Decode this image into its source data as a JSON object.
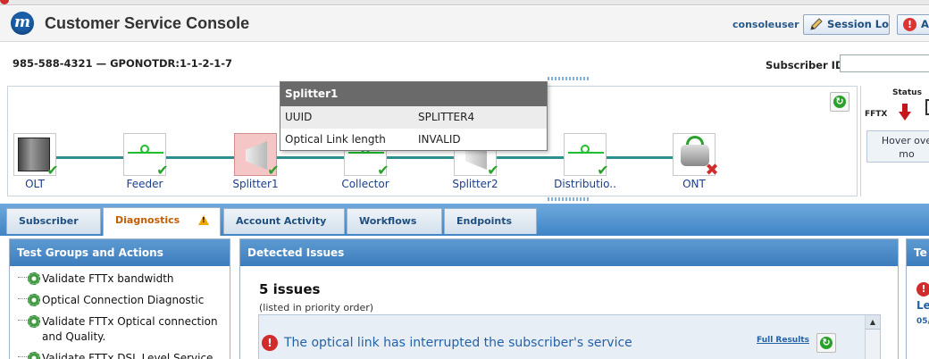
{
  "app": {
    "title": "Customer Service Console",
    "logo_letter": "m",
    "user": "consoleuser",
    "session_log_label": "Session Log",
    "alert_label": "A"
  },
  "subscriber": {
    "line": "985-588-4321 — GPONOTDR:1-1-2-1-7",
    "id_label": "Subscriber ID:",
    "id_value": ""
  },
  "topology": {
    "nodes": [
      {
        "label": "OLT",
        "status": "ok",
        "icon": "olt-icon"
      },
      {
        "label": "Feeder",
        "status": "ok",
        "icon": "fiber-icon"
      },
      {
        "label": "Splitter1",
        "status": "ok",
        "icon": "splitter-icon",
        "selected": true
      },
      {
        "label": "Collector",
        "status": "ok",
        "icon": "fiber-icon"
      },
      {
        "label": "Splitter2",
        "status": "ok",
        "icon": "splitter-icon"
      },
      {
        "label": "Distributio..",
        "status": "ok",
        "icon": "fiber-icon"
      },
      {
        "label": "ONT",
        "status": "error",
        "icon": "ont-icon"
      }
    ],
    "popup": {
      "title": "Splitter1",
      "rows": [
        {
          "key": "UUID",
          "value": "SPLITTER4"
        },
        {
          "key": "Optical Link length",
          "value": "INVALID"
        }
      ]
    }
  },
  "status": {
    "title": "Status",
    "fftx_label": "FFTX",
    "hover_note": "Hover ove\nmo"
  },
  "tabs": [
    {
      "label": "Subscriber",
      "active": false
    },
    {
      "label": "Diagnostics",
      "active": true,
      "warning": true
    },
    {
      "label": "Account Activity",
      "active": false
    },
    {
      "label": "Workflows",
      "active": false
    },
    {
      "label": "Endpoints",
      "active": false
    }
  ],
  "test_groups": {
    "title": "Test Groups and Actions",
    "items": [
      "Validate FTTx bandwidth",
      "Optical Connection Diagnostic",
      "Validate FTTx Optical connection and Quality.",
      "Validate FTTx DSL Level Service"
    ]
  },
  "issues": {
    "title": "Detected Issues",
    "count_text": "5 issues",
    "sub_text": "(listed in priority order)",
    "first_issue": "The optical link has interrupted the subscriber's service",
    "full_results_label": "Full Results"
  },
  "right_panel": {
    "title": "Te",
    "link_text": "Le",
    "date_text": "05/"
  },
  "colors": {
    "accent": "#3f85c6",
    "active_tab_text": "#c45d00",
    "error": "#d12b2b",
    "ok": "#2aa12a"
  }
}
